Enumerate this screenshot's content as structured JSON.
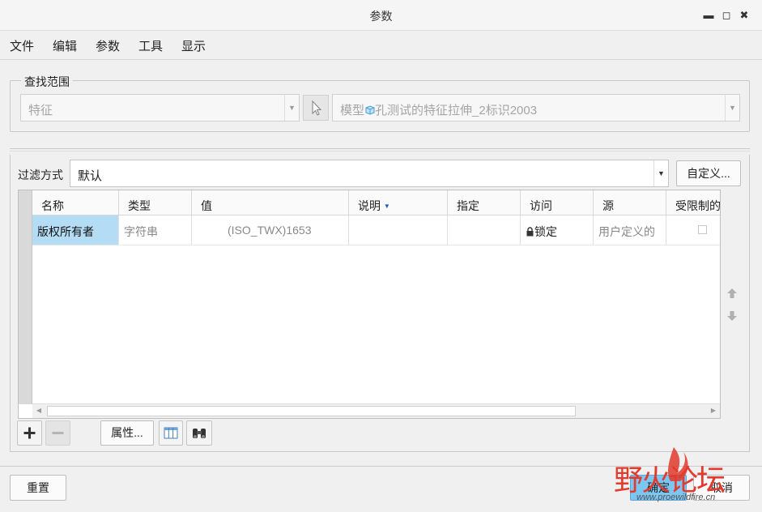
{
  "window": {
    "title": "参数"
  },
  "menu": [
    "文件",
    "编辑",
    "参数",
    "工具",
    "显示"
  ],
  "scope": {
    "legend": "查找范围",
    "type_value": "特征",
    "model_prefix": "模型",
    "model_value": "孔测试的特征拉伸_2标识2003"
  },
  "filter": {
    "label": "过滤方式",
    "value": "默认",
    "customize_label": "自定义..."
  },
  "table": {
    "columns": [
      "名称",
      "类型",
      "值",
      "说明",
      "指定",
      "访问",
      "源",
      "受限制的"
    ],
    "rows": [
      {
        "name": "版权所有者",
        "type": "字符串",
        "value": "(ISO_TWX)1653",
        "description": "",
        "designate": "",
        "access": "锁定",
        "source": "用户定义的",
        "restricted": false
      }
    ]
  },
  "toolbar": {
    "properties_label": "属性..."
  },
  "footer": {
    "reset_label": "重置",
    "ok_label": "确定",
    "cancel_label": "取消"
  },
  "watermark": {
    "text": "野火论坛",
    "url": "www.proewildfire.cn"
  },
  "colors": {
    "selection": "#b4dcf5",
    "ok_button": "#7cc6f2",
    "watermark_red": "#e23a2c"
  }
}
